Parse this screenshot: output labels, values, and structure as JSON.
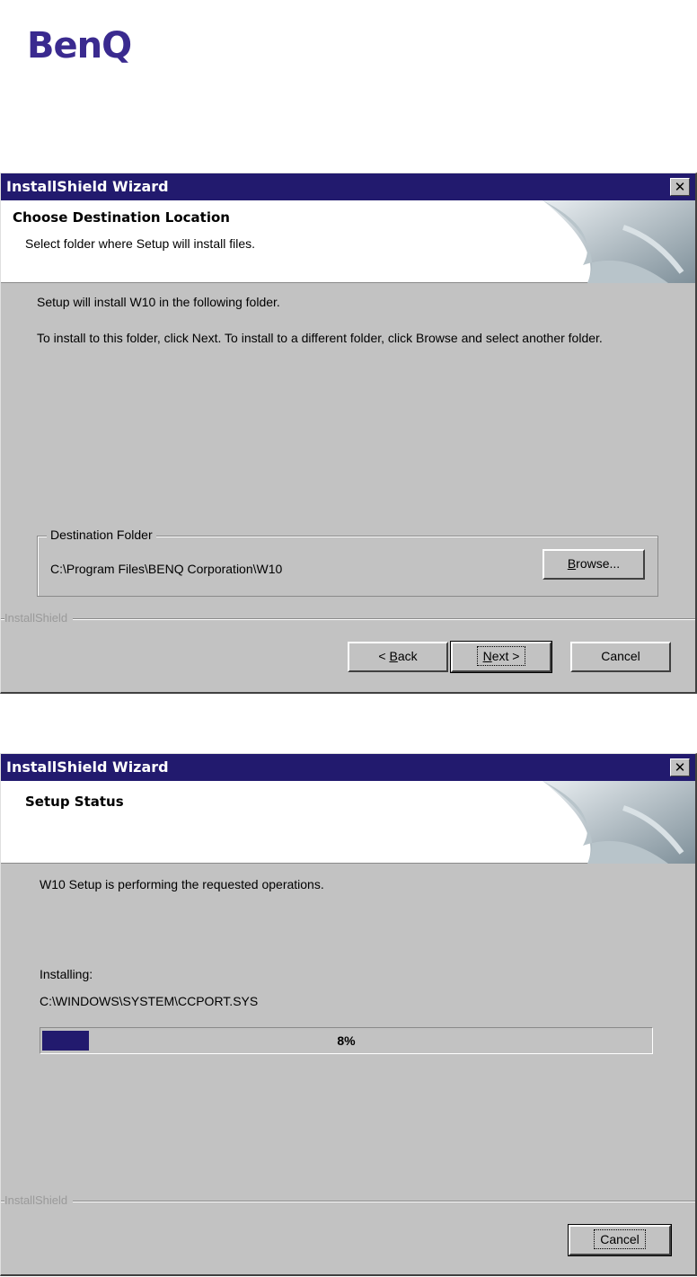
{
  "brand": {
    "logo_text": "BenQ",
    "logo_color": "#3a2a8f"
  },
  "colors": {
    "titlebar": "#221a6e",
    "dialog_bg": "#c2c2c2",
    "progress_fill": "#221a6e"
  },
  "dialog1": {
    "title": "InstallShield Wizard",
    "close_glyph": "✕",
    "header_title": "Choose Destination Location",
    "header_subtitle": "Select folder where Setup will install files.",
    "line1": "Setup will install W10 in the following folder.",
    "line2": "To install to this folder, click Next. To install to a different folder, click Browse and select another folder.",
    "group_label": "Destination Folder",
    "destination_path": "C:\\Program Files\\BENQ Corporation\\W10",
    "browse_label": {
      "accel": "B",
      "rest": "rowse..."
    },
    "divider_label": "InstallShield",
    "back_label": {
      "prefix": "< ",
      "accel": "B",
      "rest": "ack"
    },
    "next_label": {
      "accel": "N",
      "rest": "ext >"
    },
    "cancel_label": "Cancel"
  },
  "dialog2": {
    "title": "InstallShield Wizard",
    "close_glyph": "✕",
    "header_title": "Setup Status",
    "status_line": "W10 Setup is performing the requested operations.",
    "installing_label": "Installing:",
    "installing_file": "C:\\WINDOWS\\SYSTEM\\CCPORT.SYS",
    "progress_percent": 8,
    "progress_text": "8%",
    "divider_label": "InstallShield",
    "cancel_label": "Cancel"
  }
}
